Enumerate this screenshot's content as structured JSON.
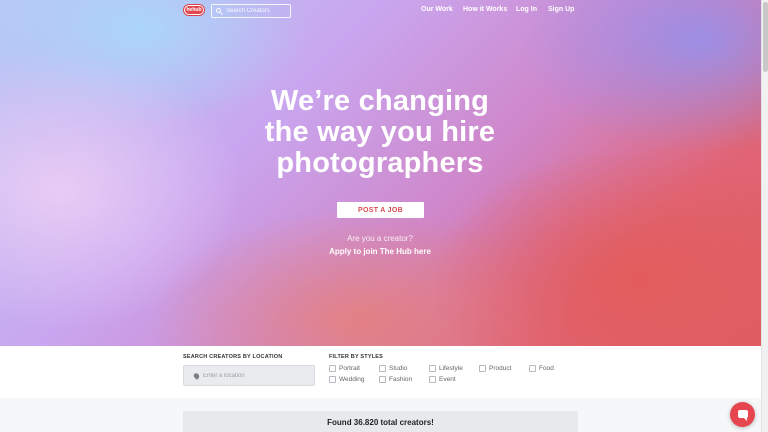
{
  "logo": {
    "text": "hehub"
  },
  "search": {
    "placeholder": "Search Creators"
  },
  "nav": {
    "links": [
      "Our Work",
      "How it Works",
      "Log In",
      "Sign Up"
    ]
  },
  "hero": {
    "title_lines": [
      "We’re changing",
      "the way you hire",
      "photographers"
    ],
    "cta_label": "POST A JOB",
    "creator_question": "Are you a creator?",
    "creator_link": "Apply to join The Hub here"
  },
  "filters": {
    "location_label": "SEARCH CREATORS BY LOCATION",
    "location_placeholder": "Enter a location",
    "styles_label": "FILTER BY STYLES",
    "styles": [
      "Portrait",
      "Studio",
      "Lifestyle",
      "Product",
      "Food",
      "Wedding",
      "Fashion",
      "Event"
    ]
  },
  "results": {
    "text": "Found 36.820 total creators!"
  },
  "colors": {
    "brand": "#e0474f",
    "cta_text": "#d94a52"
  },
  "icons": {
    "search": "search-icon",
    "location": "map-pin-icon",
    "chat": "chat-icon"
  }
}
